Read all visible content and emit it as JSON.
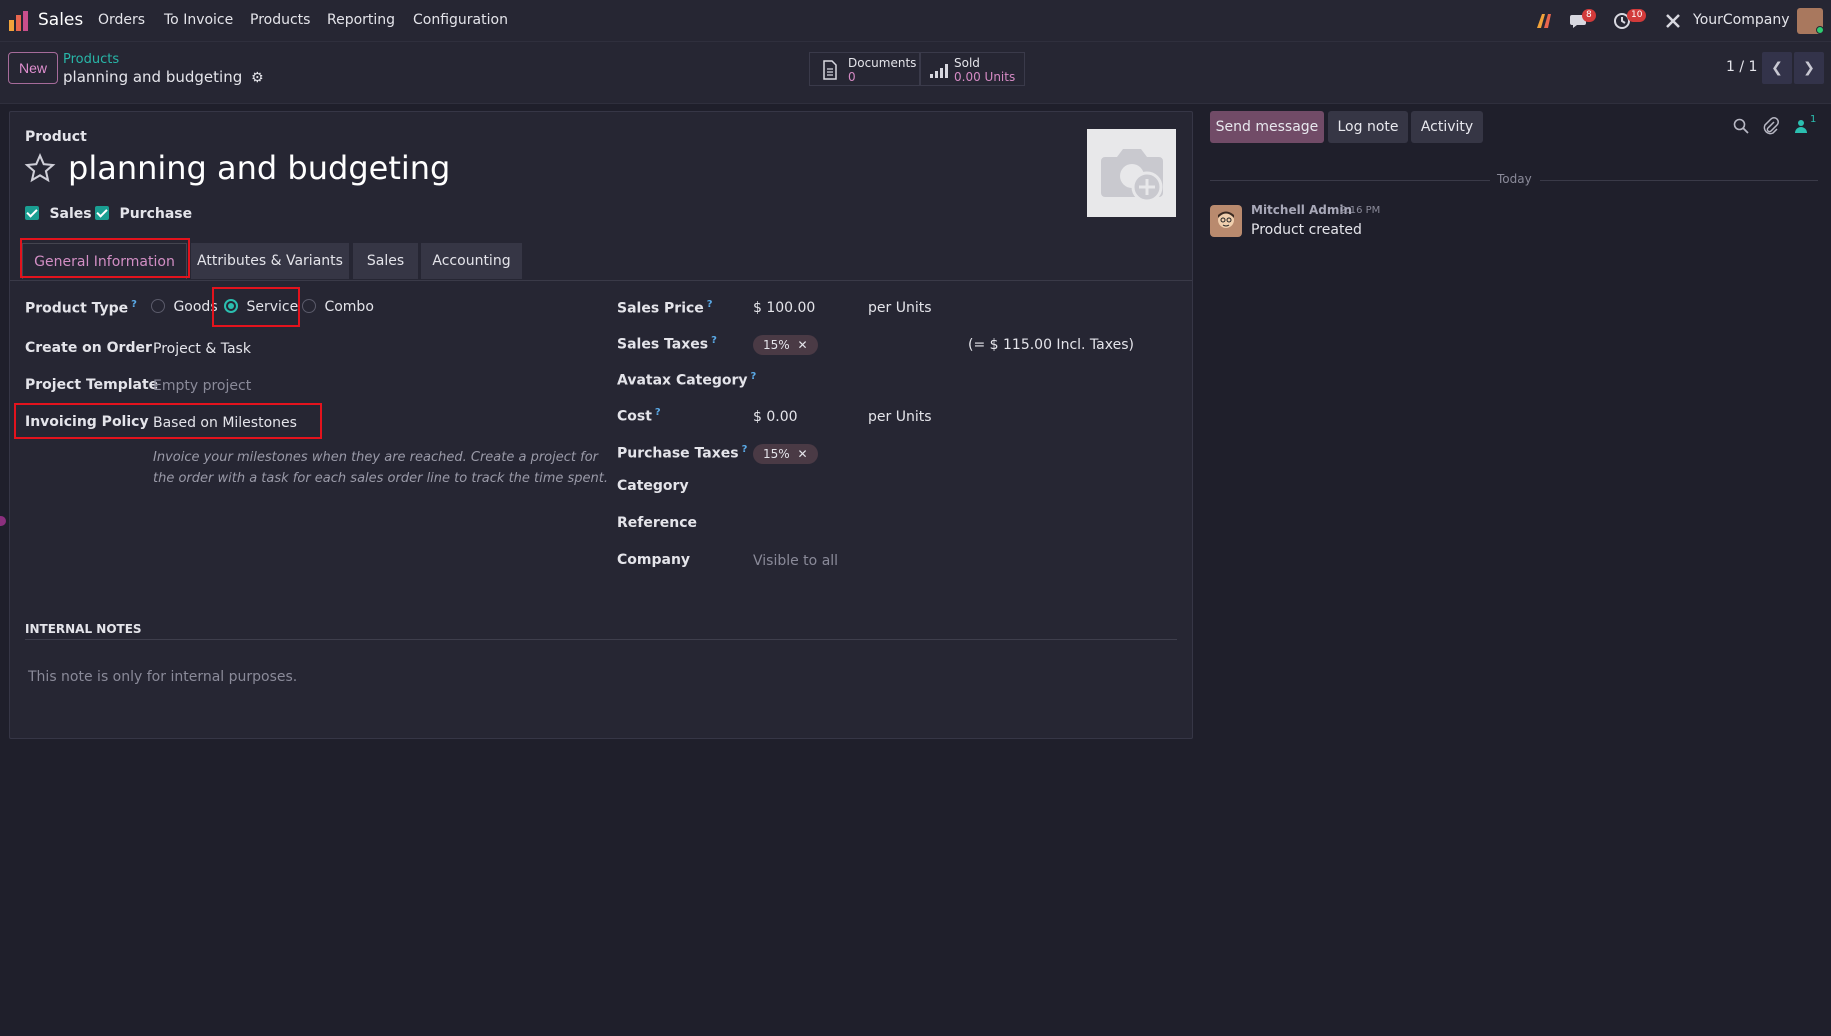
{
  "navbar": {
    "app_name": "Sales",
    "menus": [
      "Orders",
      "To Invoice",
      "Products",
      "Reporting",
      "Configuration"
    ],
    "messages_count": "8",
    "activities_count": "10",
    "company": "YourCompany"
  },
  "control_panel": {
    "new_label": "New",
    "breadcrumb": "Products",
    "record_name": "planning and budgeting",
    "documents_label": "Documents",
    "documents_value": "0",
    "sold_label": "Sold",
    "sold_value": "0.00 Units",
    "pager": "1 / 1"
  },
  "form": {
    "product_label": "Product",
    "product_name": "planning and budgeting",
    "sales_check_label": "Sales",
    "purchase_check_label": "Purchase",
    "tabs": [
      "General Information",
      "Attributes & Variants",
      "Sales",
      "Accounting"
    ],
    "left": {
      "product_type_label": "Product Type",
      "product_type_options": [
        "Goods",
        "Service",
        "Combo"
      ],
      "product_type_selected": "Service",
      "create_on_order_label": "Create on Order",
      "create_on_order_value": "Project & Task",
      "project_template_label": "Project Template",
      "project_template_placeholder": "Empty project",
      "invoicing_policy_label": "Invoicing Policy",
      "invoicing_policy_value": "Based on Milestones",
      "invoicing_help_line1": "Invoice your milestones when they are reached. Create a project for",
      "invoicing_help_line2": "the order with a task for each sales order line to track the time spent."
    },
    "right": {
      "sales_price_label": "Sales Price",
      "sales_price_value": "$ 100.00",
      "sales_price_unit": "per Units",
      "sales_taxes_label": "Sales Taxes",
      "sales_taxes_tag": "15%",
      "sales_taxes_incl": "(= $ 115.00 Incl. Taxes)",
      "avatax_label": "Avatax Category",
      "cost_label": "Cost",
      "cost_value": "$ 0.00",
      "cost_unit": "per Units",
      "purchase_taxes_label": "Purchase Taxes",
      "purchase_taxes_tag": "15%",
      "category_label": "Category",
      "reference_label": "Reference",
      "company_label": "Company",
      "company_placeholder": "Visible to all"
    },
    "internal_notes_title": "INTERNAL NOTES",
    "internal_notes_placeholder": "This note is only for internal purposes."
  },
  "chatter": {
    "send_message": "Send message",
    "log_note": "Log note",
    "activity": "Activity",
    "followers_count": "1",
    "date_separator": "Today",
    "author": "Mitchell Admin",
    "time": "2:16 PM",
    "message": "Product created"
  },
  "colors": {
    "accent": "#714b67",
    "teal": "#1a9e92",
    "highlight": "#e3131d"
  }
}
